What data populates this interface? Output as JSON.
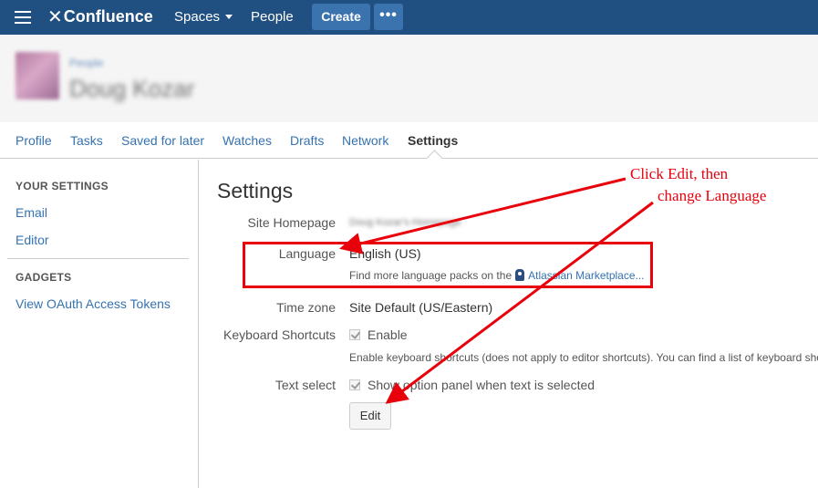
{
  "topnav": {
    "logo_mark": "✕",
    "logo_text": "Confluence",
    "spaces_label": "Spaces",
    "people_label": "People",
    "create_label": "Create",
    "more_label": "•••",
    "icons": {
      "menu": "hamburger-icon",
      "caret": "chevron-down-icon"
    }
  },
  "profile": {
    "breadcrumb": "People",
    "name": "Doug Kozar"
  },
  "tabs": [
    {
      "label": "Profile",
      "active": false
    },
    {
      "label": "Tasks",
      "active": false
    },
    {
      "label": "Saved for later",
      "active": false
    },
    {
      "label": "Watches",
      "active": false
    },
    {
      "label": "Drafts",
      "active": false
    },
    {
      "label": "Network",
      "active": false
    },
    {
      "label": "Settings",
      "active": true
    }
  ],
  "sidebar": {
    "your_settings_heading": "YOUR SETTINGS",
    "email_label": "Email",
    "editor_label": "Editor",
    "gadgets_heading": "GADGETS",
    "oauth_label": "View OAuth Access Tokens"
  },
  "settings": {
    "title": "Settings",
    "site_homepage_label": "Site Homepage",
    "site_homepage_value": "Doug Kozar's Homepage",
    "language_label": "Language",
    "language_value": "English (US)",
    "language_note_prefix": "Find more language packs on the",
    "language_note_link": "Atlassian Marketplace...",
    "timezone_label": "Time zone",
    "timezone_value": "Site Default (US/Eastern)",
    "keyboard_label": "Keyboard Shortcuts",
    "keyboard_value": "Enable",
    "keyboard_note": "Enable keyboard shortcuts (does not apply to editor shortcuts). You can find a list of keyboard shortcuts",
    "text_select_label": "Text select",
    "text_select_value": "Show option panel when text is selected",
    "edit_label": "Edit"
  },
  "annotation": {
    "line1": "Click Edit, then",
    "line2": "change Language",
    "color": "#e8000b"
  }
}
